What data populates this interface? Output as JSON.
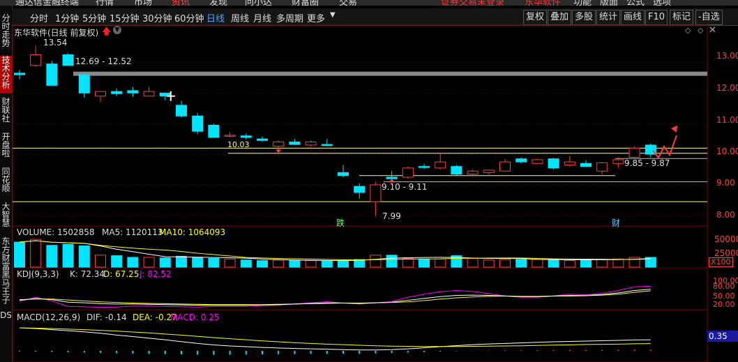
{
  "top_bar": {
    "items": [
      "通达信金融终端",
      "行情",
      "市场",
      "资讯",
      "发现",
      "问小达",
      "财富圈",
      "交易"
    ],
    "right_items": [
      "证券交易未登录",
      "东华软件",
      "功能",
      "版面",
      "公式",
      "选项"
    ]
  },
  "sidebar": {
    "tabs": [
      "分时走势",
      "技术分析",
      "财联社",
      "开盘啦",
      "同花顺",
      "大智慧",
      "东方财富",
      "黑马王子",
      "DS"
    ]
  },
  "toolbar": {
    "periods": [
      "分时",
      "1分钟",
      "5分钟",
      "15分钟",
      "30分钟",
      "60分钟",
      "日线",
      "周线",
      "月线",
      "多周期",
      "更多"
    ],
    "selected": "日线",
    "buttons": [
      "复权",
      "叠加",
      "多股",
      "统计",
      "画线",
      "F10",
      "标记",
      "-自选"
    ]
  },
  "main_chart": {
    "title": "东华软件(日线 前复权)",
    "price_ticks": [
      "13.00",
      "12.00",
      "11.00",
      "10.00",
      "9.00",
      "8.00"
    ],
    "annotations": {
      "high": "13.54",
      "range_top": "12.69 - 12.52",
      "level": "10.03",
      "range_mid": "9.10 - 9.11",
      "low": "7.99",
      "range_right": "9.85 - 9.87",
      "tag_die": "跌",
      "tag_cai": "财"
    }
  },
  "volume": {
    "label": "VOLUME: 1502858",
    "ma5": "MA5: 1120113",
    "ma10": "MA10: 1064093",
    "ticks": [
      "50000",
      "25000"
    ],
    "unit": "X100"
  },
  "kdj": {
    "label": "KDJ(9,3,3)",
    "k": "K: 72.34",
    "d": "D: 67.25",
    "j": "J: 82.52",
    "ticks": [
      "100.00",
      "80.00",
      "50.00",
      "20.00"
    ]
  },
  "macd": {
    "label": "MACD(12,26,9)",
    "dif": "DIF: -0.14",
    "dea": "DEA: -0.27",
    "macd": "MACD: 0.25",
    "value_badge": "0.35"
  },
  "chart_data": {
    "type": "candlestick",
    "title": "东华软件(日线 前复权)",
    "ylim": [
      7.7,
      13.9
    ],
    "candles": [
      {
        "o": 12.65,
        "h": 12.75,
        "l": 12.45,
        "c": 12.6
      },
      {
        "o": 12.9,
        "h": 13.54,
        "l": 12.85,
        "c": 13.25
      },
      {
        "o": 12.95,
        "h": 13.05,
        "l": 12.25,
        "c": 12.25
      },
      {
        "o": 13.25,
        "h": 13.3,
        "l": 12.9,
        "c": 12.9
      },
      {
        "o": 12.6,
        "h": 12.65,
        "l": 11.85,
        "c": 12.0
      },
      {
        "o": 11.9,
        "h": 12.05,
        "l": 11.7,
        "c": 12.05
      },
      {
        "o": 12.05,
        "h": 12.15,
        "l": 11.9,
        "c": 11.98
      },
      {
        "o": 12.08,
        "h": 12.2,
        "l": 11.88,
        "c": 12.0
      },
      {
        "o": 11.9,
        "h": 12.2,
        "l": 11.9,
        "c": 12.05
      },
      {
        "o": 12.0,
        "h": 12.0,
        "l": 11.75,
        "c": 11.9
      },
      {
        "o": 11.6,
        "h": 11.75,
        "l": 11.2,
        "c": 11.25
      },
      {
        "o": 11.25,
        "h": 11.35,
        "l": 10.65,
        "c": 10.75
      },
      {
        "o": 10.95,
        "h": 11.0,
        "l": 10.55,
        "c": 10.55
      },
      {
        "o": 10.6,
        "h": 10.72,
        "l": 10.55,
        "c": 10.62
      },
      {
        "o": 10.6,
        "h": 10.68,
        "l": 10.48,
        "c": 10.55
      },
      {
        "o": 10.5,
        "h": 10.58,
        "l": 10.4,
        "c": 10.45
      },
      {
        "o": 10.26,
        "h": 10.45,
        "l": 10.0,
        "c": 10.4
      },
      {
        "o": 10.4,
        "h": 10.5,
        "l": 10.3,
        "c": 10.32
      },
      {
        "o": 10.3,
        "h": 10.45,
        "l": 10.25,
        "c": 10.4
      },
      {
        "o": 10.32,
        "h": 10.5,
        "l": 10.26,
        "c": 10.3
      },
      {
        "o": 9.4,
        "h": 9.65,
        "l": 9.25,
        "c": 9.3
      },
      {
        "o": 8.95,
        "h": 9.05,
        "l": 8.55,
        "c": 8.75
      },
      {
        "o": 8.45,
        "h": 9.1,
        "l": 7.99,
        "c": 9.0
      },
      {
        "o": 9.25,
        "h": 9.45,
        "l": 9.1,
        "c": 9.2
      },
      {
        "o": 9.25,
        "h": 9.6,
        "l": 9.2,
        "c": 9.55
      },
      {
        "o": 9.6,
        "h": 9.68,
        "l": 9.52,
        "c": 9.58
      },
      {
        "o": 9.55,
        "h": 10.05,
        "l": 9.5,
        "c": 9.75
      },
      {
        "o": 9.6,
        "h": 9.65,
        "l": 9.3,
        "c": 9.35
      },
      {
        "o": 9.35,
        "h": 9.5,
        "l": 9.3,
        "c": 9.45
      },
      {
        "o": 9.4,
        "h": 9.5,
        "l": 9.35,
        "c": 9.48
      },
      {
        "o": 9.45,
        "h": 9.85,
        "l": 9.45,
        "c": 9.75
      },
      {
        "o": 9.85,
        "h": 9.9,
        "l": 9.7,
        "c": 9.75
      },
      {
        "o": 9.7,
        "h": 9.85,
        "l": 9.68,
        "c": 9.82
      },
      {
        "o": 9.85,
        "h": 9.88,
        "l": 9.5,
        "c": 9.55
      },
      {
        "o": 9.65,
        "h": 9.95,
        "l": 9.6,
        "c": 9.75
      },
      {
        "o": 9.7,
        "h": 9.8,
        "l": 9.6,
        "c": 9.6
      },
      {
        "o": 9.45,
        "h": 9.75,
        "l": 9.35,
        "c": 9.72
      },
      {
        "o": 9.7,
        "h": 9.9,
        "l": 9.55,
        "c": 9.82
      },
      {
        "o": 9.9,
        "h": 10.25,
        "l": 9.85,
        "c": 10.2
      },
      {
        "o": 10.3,
        "h": 10.35,
        "l": 9.9,
        "c": 10.0
      }
    ],
    "volume_units": "X100",
    "volume": [
      46000,
      51000,
      40000,
      42000,
      39000,
      22000,
      21000,
      18000,
      18000,
      17000,
      20000,
      18000,
      16000,
      15000,
      13000,
      12000,
      13000,
      12000,
      12000,
      12000,
      12000,
      14000,
      22000,
      22000,
      16000,
      15000,
      15000,
      21000,
      16000,
      13000,
      14000,
      14000,
      14000,
      14000,
      12000,
      14000,
      14000,
      15000,
      18000,
      18000
    ],
    "kdj": {
      "k": [
        36,
        42,
        38,
        30,
        28,
        25,
        24,
        24,
        23,
        22,
        21,
        20,
        20,
        20,
        20,
        21,
        22,
        24,
        26,
        28,
        27,
        26,
        28,
        30,
        36,
        42,
        48,
        52,
        53,
        52,
        50,
        48,
        48,
        50,
        52,
        52,
        55,
        60,
        68,
        72
      ],
      "d": [
        38,
        40,
        40,
        37,
        34,
        31,
        29,
        27,
        26,
        25,
        24,
        23,
        22,
        22,
        22,
        22,
        23,
        24,
        25,
        26,
        27,
        27,
        28,
        29,
        31,
        35,
        40,
        44,
        47,
        49,
        50,
        49,
        49,
        50,
        50,
        51,
        53,
        56,
        62,
        67
      ],
      "j": [
        32,
        46,
        34,
        16,
        15,
        13,
        14,
        17,
        17,
        16,
        15,
        14,
        16,
        16,
        16,
        19,
        20,
        24,
        28,
        32,
        27,
        24,
        28,
        32,
        46,
        56,
        64,
        68,
        65,
        58,
        50,
        46,
        46,
        50,
        56,
        54,
        59,
        68,
        80,
        82
      ]
    },
    "macd": {
      "dif": [
        0.52,
        0.48,
        0.42,
        0.36,
        0.3,
        0.22,
        0.12,
        0.04,
        -0.05,
        -0.14,
        -0.24,
        -0.34,
        -0.42,
        -0.48,
        -0.52,
        -0.56,
        -0.59,
        -0.62,
        -0.64,
        -0.66,
        -0.68,
        -0.7,
        -0.7,
        -0.68,
        -0.64,
        -0.58,
        -0.52,
        -0.46,
        -0.41,
        -0.37,
        -0.34,
        -0.31,
        -0.28,
        -0.25,
        -0.23,
        -0.21,
        -0.19,
        -0.17,
        -0.15,
        -0.14
      ],
      "dea": [
        0.6,
        0.58,
        0.56,
        0.53,
        0.5,
        0.46,
        0.42,
        0.37,
        0.32,
        0.26,
        0.2,
        0.13,
        0.06,
        0.0,
        -0.06,
        -0.12,
        -0.17,
        -0.22,
        -0.26,
        -0.3,
        -0.33,
        -0.36,
        -0.39,
        -0.41,
        -0.42,
        -0.43,
        -0.43,
        -0.43,
        -0.42,
        -0.41,
        -0.4,
        -0.39,
        -0.37,
        -0.35,
        -0.34,
        -0.32,
        -0.31,
        -0.3,
        -0.28,
        -0.27
      ],
      "hist": [
        -0.16,
        -0.2,
        -0.28,
        -0.34,
        -0.4,
        -0.48,
        -0.6,
        -0.66,
        -0.74,
        -0.8,
        -0.88,
        -0.94,
        -0.96,
        -0.96,
        -0.92,
        -0.88,
        -0.84,
        -0.8,
        -0.76,
        -0.72,
        -0.7,
        -0.68,
        -0.62,
        -0.54,
        -0.44,
        -0.3,
        -0.18,
        -0.06,
        0.02,
        0.08,
        0.12,
        0.16,
        0.18,
        0.2,
        0.22,
        0.22,
        0.24,
        0.26,
        0.26,
        0.25
      ]
    }
  },
  "colors": {
    "up": "#ff3c3c",
    "down": "#00e5ff",
    "sel_tab": "#b00000",
    "grid": "#4a0000",
    "kline": "#ffffff",
    "dline": "#ffff00",
    "jline": "#ff00ff",
    "level": "#ffff66"
  }
}
